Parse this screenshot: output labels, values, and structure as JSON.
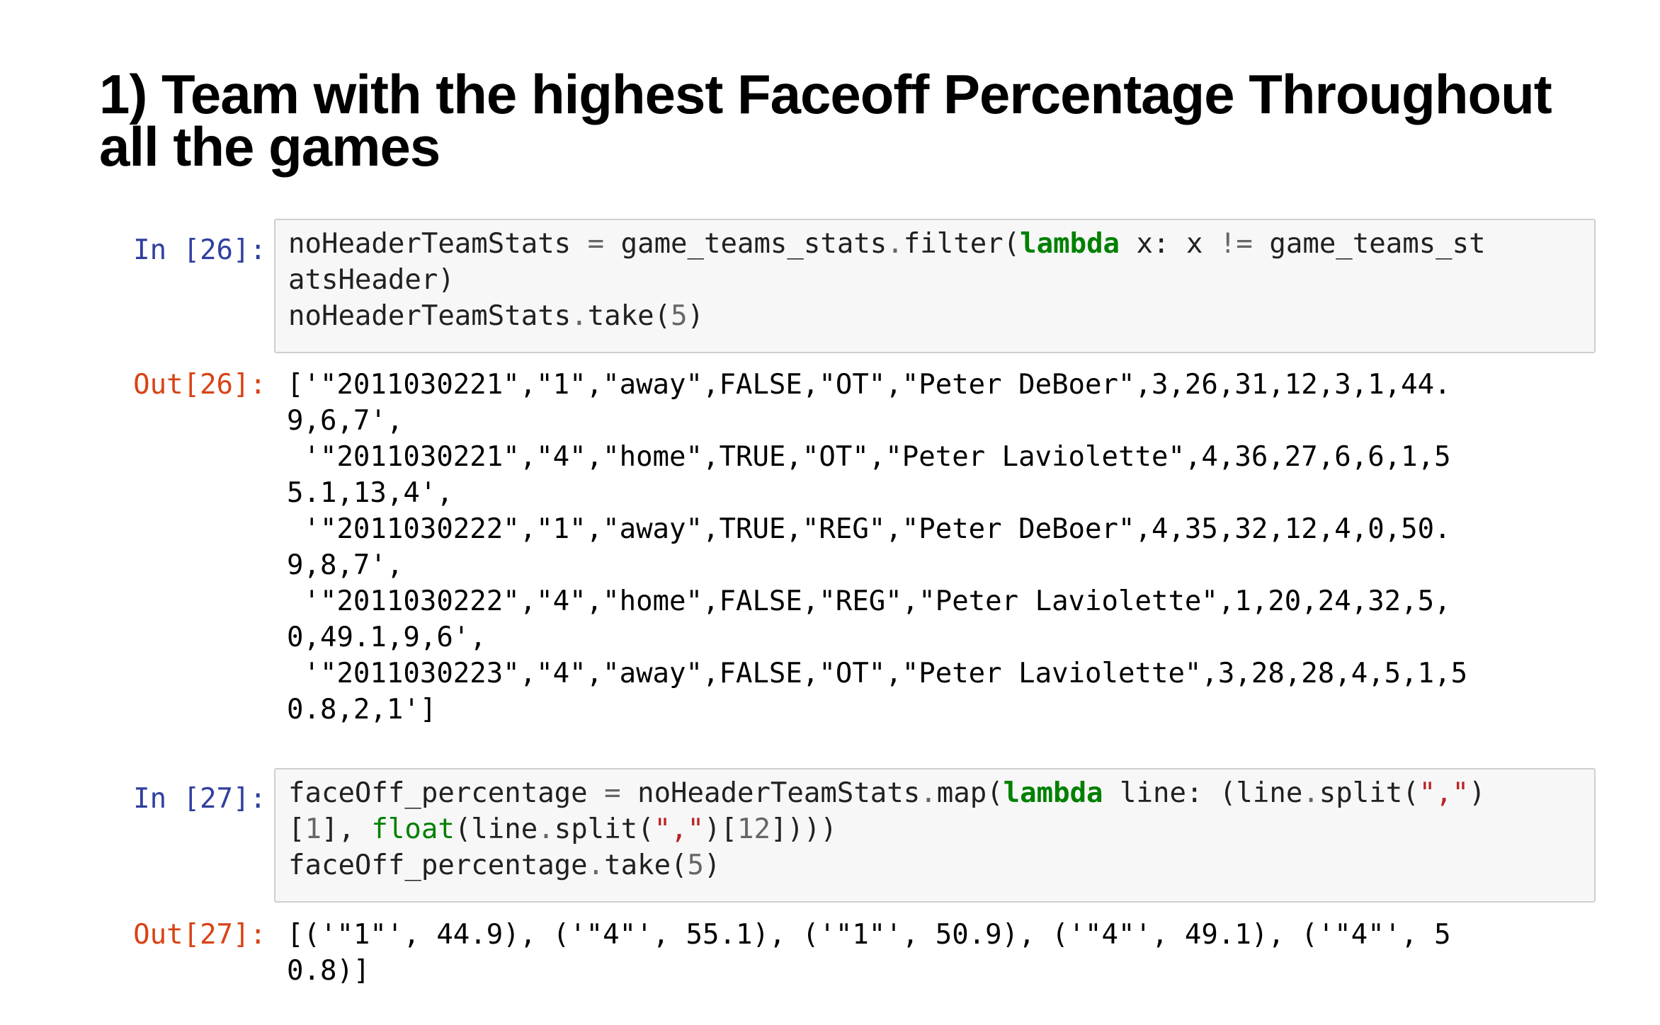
{
  "heading": {
    "line1": "1) Team with the highest Faceoff Percentage Throughout",
    "line2": "all the games"
  },
  "cells": [
    {
      "in_prompt": "In [26]:",
      "out_prompt": "Out[26]:",
      "code": {
        "l1_a": "noHeaderTeamStats ",
        "l1_op1": "=",
        "l1_b": " game_teams_stats",
        "l1_dot1": ".",
        "l1_c": "filter(",
        "l1_kw": "lambda",
        "l1_d": " x: x ",
        "l1_op2": "!=",
        "l1_e": " game_teams_st",
        "l2": "atsHeader)",
        "l3_a": "noHeaderTeamStats",
        "l3_dot": ".",
        "l3_b": "take(",
        "l3_num": "5",
        "l3_c": ")"
      },
      "output_lines": [
        "['\"2011030221\",\"1\",\"away\",FALSE,\"OT\",\"Peter DeBoer\",3,26,31,12,3,1,44.",
        "9,6,7',",
        " '\"2011030221\",\"4\",\"home\",TRUE,\"OT\",\"Peter Laviolette\",4,36,27,6,6,1,5",
        "5.1,13,4',",
        " '\"2011030222\",\"1\",\"away\",TRUE,\"REG\",\"Peter DeBoer\",4,35,32,12,4,0,50.",
        "9,8,7',",
        " '\"2011030222\",\"4\",\"home\",FALSE,\"REG\",\"Peter Laviolette\",1,20,24,32,5,",
        "0,49.1,9,6',",
        " '\"2011030223\",\"4\",\"away\",FALSE,\"OT\",\"Peter Laviolette\",3,28,28,4,5,1,5",
        "0.8,2,1']"
      ]
    },
    {
      "in_prompt": "In [27]:",
      "out_prompt": "Out[27]:",
      "code": {
        "l1_a": "faceOff_percentage ",
        "l1_op1": "=",
        "l1_b": " noHeaderTeamStats",
        "l1_dot1": ".",
        "l1_c": "map(",
        "l1_kw": "lambda",
        "l1_d": " line: (line",
        "l1_dot2": ".",
        "l1_e": "split(",
        "l1_str": "\",\"",
        "l1_f": ")",
        "l2_a": "[",
        "l2_num1": "1",
        "l2_b": "], ",
        "l2_bi": "float",
        "l2_c": "(line",
        "l2_dot": ".",
        "l2_d": "split(",
        "l2_str": "\",\"",
        "l2_e": ")[",
        "l2_num2": "12",
        "l2_f": "])))",
        "l3_a": "faceOff_percentage",
        "l3_dot": ".",
        "l3_b": "take(",
        "l3_num": "5",
        "l3_c": ")"
      },
      "output_lines": [
        "[('\"1\"', 44.9), ('\"4\"', 55.1), ('\"1\"', 50.9), ('\"4\"', 49.1), ('\"4\"', 5",
        "0.8)]"
      ]
    }
  ]
}
